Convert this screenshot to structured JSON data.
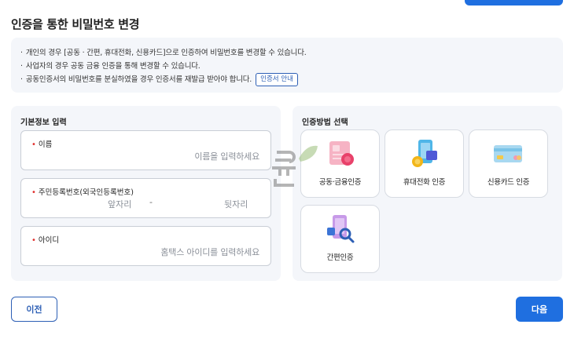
{
  "header": {
    "title": "인증을 통한 비밀번호 변경"
  },
  "notice": {
    "lines": [
      "개인의 경우 [공동 · 간편, 휴대전화, 신용카드]으로 인증하여 비밀번호를 변경할 수 있습니다.",
      "사업자의 경우  공동  금융 인증을 통해 변경할 수 있습니다.",
      "공동인증서의 비밀번호를 분실하였을 경우 인증서를 재발급 받아야 합니다."
    ],
    "bullet": "·",
    "cert_guide_label": "인증서 안내"
  },
  "basic_info": {
    "title": "기본정보 입력",
    "required_mark": "•",
    "name_field": {
      "label": "이름",
      "placeholder": "이름을 입력하세요"
    },
    "rrn_field": {
      "label": "주민등록번호(외국인등록번호)",
      "front_placeholder": "앞자리",
      "separator": "-",
      "back_placeholder": "뒷자리"
    },
    "id_field": {
      "label": "아이디",
      "placeholder": "홈택스 아이디를 입력하세요"
    }
  },
  "auth_method": {
    "title": "인증방법 선택",
    "methods": [
      {
        "label": "공동·금융인증",
        "icon": "certificate-icon"
      },
      {
        "label": "휴대전화 인증",
        "icon": "mobile-phone-icon"
      },
      {
        "label": "신용카드 인증",
        "icon": "credit-card-icon"
      },
      {
        "label": "간편인증",
        "icon": "simple-auth-icon"
      }
    ]
  },
  "footer": {
    "prev_label": "이전",
    "next_label": "다음"
  },
  "colors": {
    "primary": "#1f6fe0",
    "outline": "#2d5fb5",
    "panel_bg": "#f4f6fa",
    "required": "#e0312e"
  }
}
